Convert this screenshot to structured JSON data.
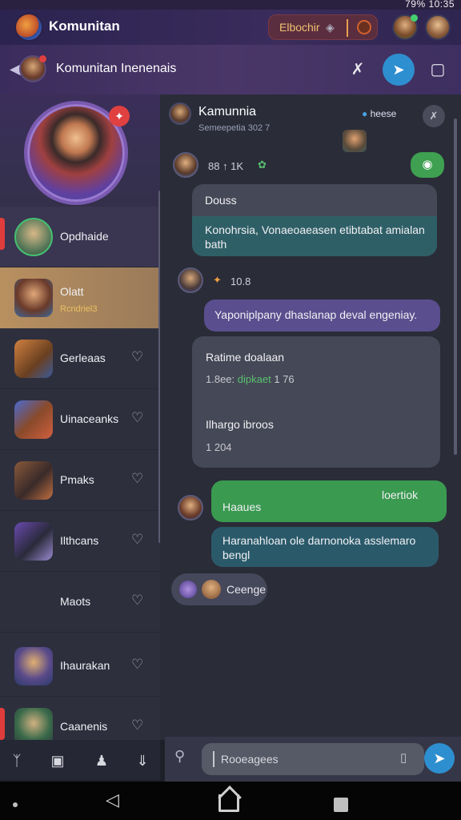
{
  "status_bar": {
    "text": "79% 10:35"
  },
  "app": {
    "title": "Komunitan"
  },
  "top_chip": {
    "label": "Elbochir"
  },
  "header": {
    "title": "Komunitan Inenenais"
  },
  "profile_item": {
    "name": "Opdhaide"
  },
  "sidebar_items": [
    {
      "name": "Olatt",
      "sub": "Rcndriel3"
    },
    {
      "name": "Gerleaas"
    },
    {
      "name": "Uinaceanks"
    },
    {
      "name": "Pmaks"
    },
    {
      "name": "Ilthcans"
    },
    {
      "name": "Maots"
    },
    {
      "name": "Ihaurakan"
    },
    {
      "name": "Caanenis"
    }
  ],
  "chat": {
    "title": "Kamunnia",
    "subtitle": "Semeepetia 302 7",
    "tag": "heese"
  },
  "messages": {
    "meta1": "88 ↑ 1K",
    "bubble1_line1": "Douss",
    "bubble1_line2": "Konohrsia, Vonaeoaeasen etibtabat amialan bath",
    "meta2": "10.8",
    "bubble2": "Yaponiplpany dhaslanap deval engeniay.",
    "bubble3_line1": "Ratime doalaan",
    "bubble3_line2_prefix": "1.8ee:",
    "bubble3_line2_green": "dipkaet",
    "bubble3_line2_suffix": "1 76",
    "bubble3_line3": "Ilhargo ibroos",
    "bubble3_line4": "1 204",
    "bubble4_right": "loertiok",
    "bubble4_left": "Haaues",
    "bubble5": "Haranahloan ole darnonoka asslemaro bengl",
    "pill": "Ceenge"
  },
  "composer": {
    "placeholder": "Rooeagees"
  },
  "colors": {
    "accent": "#2e8fd0",
    "green": "#3ea050",
    "purple": "#5a4e8e",
    "teal": "#2f5f66"
  }
}
